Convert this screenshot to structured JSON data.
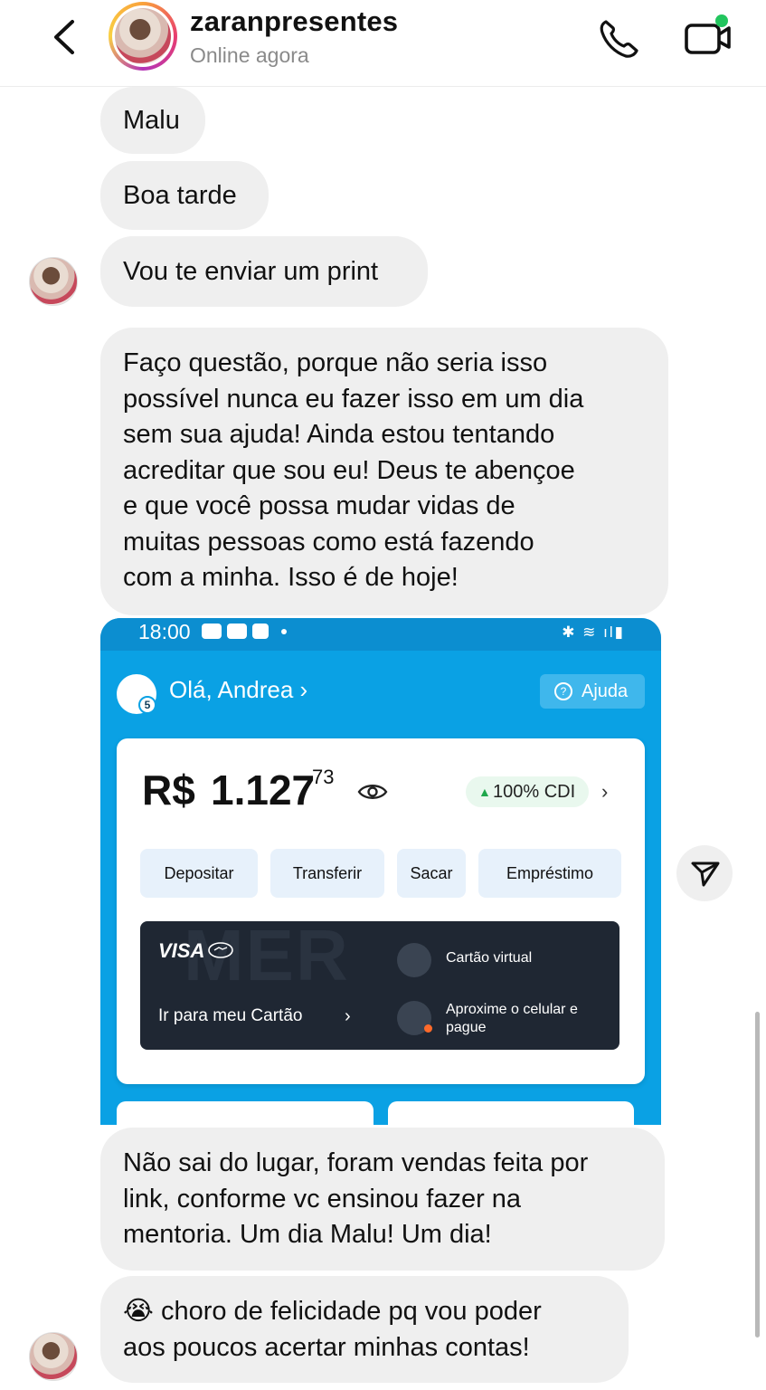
{
  "header": {
    "username": "zaranpresentes",
    "status": "Online agora"
  },
  "messages": [
    {
      "text": "Malu"
    },
    {
      "text": "Boa tarde"
    },
    {
      "text": "Vou te enviar um print"
    },
    {
      "lines": [
        "Faço questão, porque não seria isso",
        "possível nunca eu fazer isso em um dia",
        "sem sua ajuda! Ainda estou tentando",
        "acreditar que sou eu!  Deus te abençoe",
        "e que você possa mudar vidas de",
        "muitas pessoas como está fazendo",
        "com a minha.  Isso é de hoje!"
      ]
    },
    {
      "lines": [
        "Não sai do lugar, foram vendas feita por",
        "link, conforme vc ensinou fazer na",
        "mentoria.  Um dia Malu! Um dia!"
      ]
    },
    {
      "lines": [
        "😭 choro de felicidade pq vou poder",
        "aos poucos acertar minhas contas!"
      ]
    }
  ],
  "screenshot": {
    "status_time": "18:00",
    "user_badge": "5",
    "greeting": "Olá, Andrea  ›",
    "help_label": "Ajuda",
    "balance_currency": "R$",
    "balance_main": "1.127",
    "balance_cents": "73",
    "cdi_label": "100% CDI",
    "actions": [
      "Depositar",
      "Transferir",
      "Sacar",
      "Empréstimo"
    ],
    "card_brand": "VISA",
    "card_watermark": "MER",
    "card_link": "Ir para meu Cartão",
    "virtual_card": "Cartão virtual",
    "contactless": "Aproxime o celular e pague"
  },
  "colors": {
    "accent_blue": "#0aa1e4",
    "bubble_gray": "#efefef",
    "online_dot": "#22c55e"
  },
  "icons": [
    "back-arrow-icon",
    "phone-icon",
    "video-call-icon",
    "eye-icon",
    "send-icon",
    "crying-face-emoji"
  ]
}
